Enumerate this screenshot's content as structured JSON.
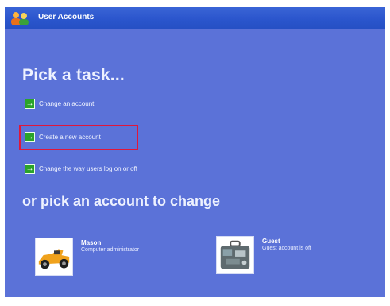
{
  "window": {
    "title": "User Accounts",
    "icon": "user-accounts-icon"
  },
  "main": {
    "pick_task_heading": "Pick a task...",
    "tasks": [
      {
        "label": "Change an account",
        "icon": "green-arrow-icon"
      },
      {
        "label": "Create a new account",
        "icon": "green-arrow-icon",
        "highlighted": true
      },
      {
        "label": "Change the way users log on or off",
        "icon": "green-arrow-icon"
      }
    ],
    "pick_account_heading": "or pick an account to change",
    "accounts": [
      {
        "name": "Mason",
        "type": "Computer administrator",
        "picture": "race-car-icon"
      },
      {
        "name": "Guest",
        "type": "Guest account is off",
        "picture": "suitcase-icon"
      }
    ]
  },
  "colors": {
    "background": "#5b72d8",
    "titlebar": "#2a55cc",
    "highlight": "#e0173b",
    "task_icon": "#2aa32a"
  }
}
